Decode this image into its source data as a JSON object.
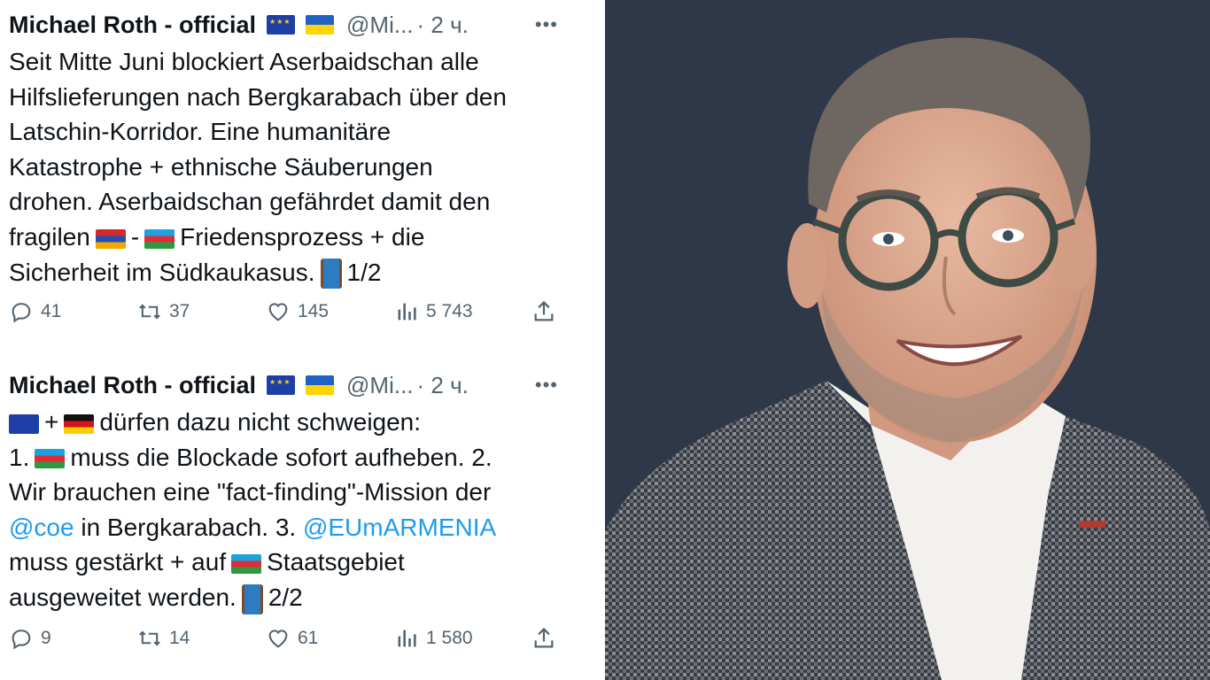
{
  "tweet1": {
    "name": "Michael Roth - official",
    "handle": "@Mi...",
    "time": "· 2 ч.",
    "more": "•••",
    "lines": [
      "Seit Mitte Juni blockiert Aserbaidschan alle",
      "Hilfslieferungen nach Bergkarabach über den",
      "Latschin-Korridor. Eine humanitäre",
      "Katastrophe + ethnische Säuberungen",
      "drohen. Aserbaidschan gefährdet damit den"
    ],
    "line6_a": "fragilen",
    "line6_b": "-",
    "line6_c": "Friedensprozess + die",
    "line7_a": "Sicherheit im Südkaukasus.",
    "line7_b": "1/2",
    "replies": "41",
    "retweets": "37",
    "likes": "145",
    "views": "5 743"
  },
  "tweet2": {
    "name": "Michael Roth - official",
    "handle": "@Mi...",
    "time": "· 2 ч.",
    "more": "•••",
    "line1_a": "+",
    "line1_b": "dürfen dazu nicht schweigen:",
    "line2_a": "1.",
    "line2_b": "muss die Blockade sofort aufheben. 2.",
    "line3": "Wir brauchen eine \"fact-finding\"-Mission der",
    "line4_mention1": "@coe",
    "line4_mid": " in Bergkarabach. 3. ",
    "line4_mention2": "@EUmARMENIA",
    "line5_a": "muss gestärkt + auf",
    "line5_b": "Staatsgebiet",
    "line6_a": "ausgeweitet werden.",
    "line6_b": "2/2",
    "replies": "9",
    "retweets": "14",
    "likes": "61",
    "views": "1 580"
  },
  "colors": {
    "text": "#0f1419",
    "muted": "#536471",
    "link": "#1d9bf0",
    "photo_bg": "#2e3848"
  },
  "icons": [
    "reply-icon",
    "retweet-icon",
    "like-icon",
    "views-icon",
    "share-icon",
    "more-icon"
  ]
}
